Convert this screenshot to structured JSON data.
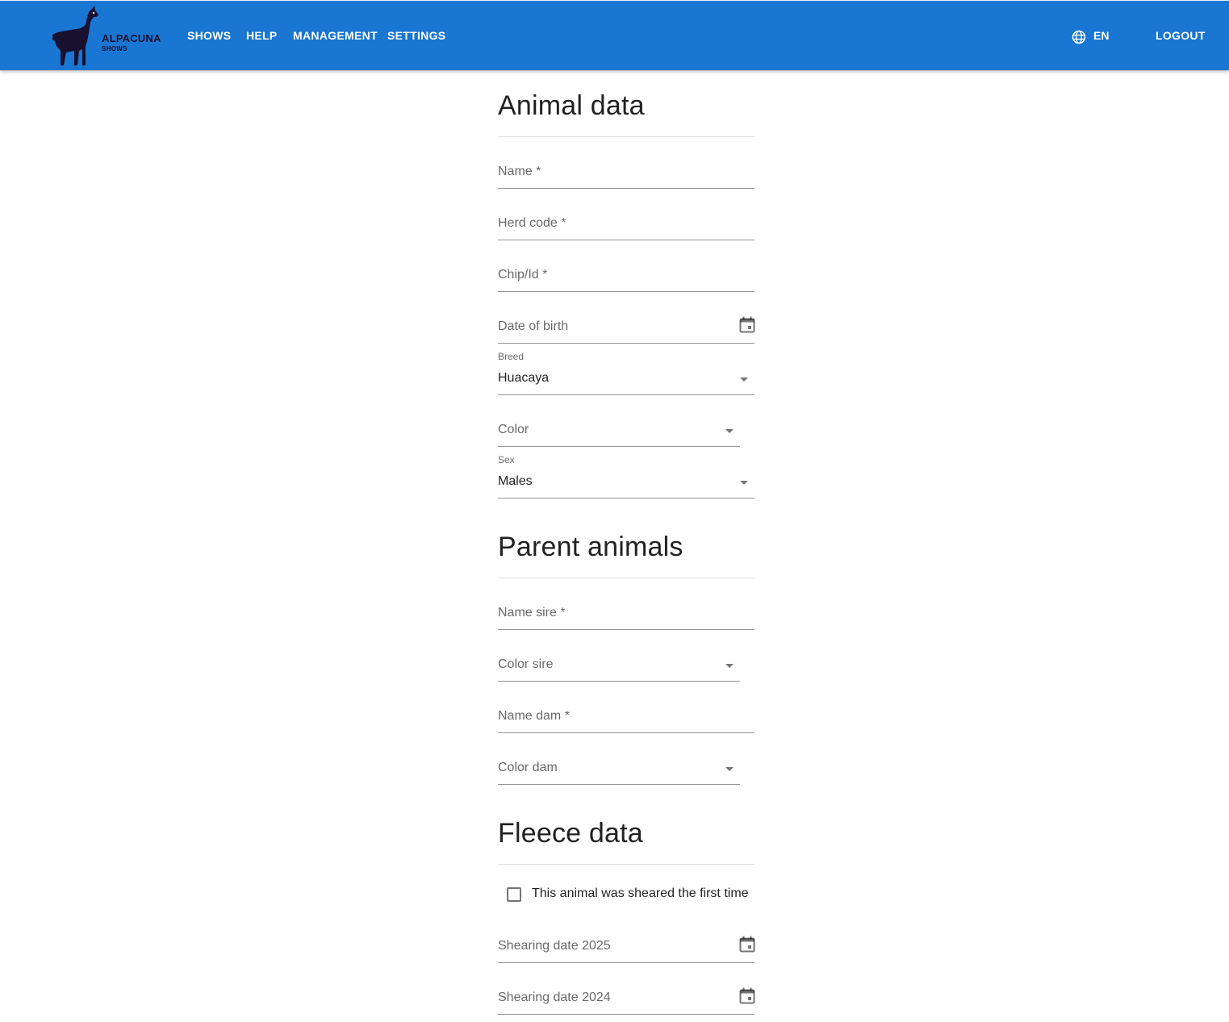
{
  "header": {
    "logo": {
      "title": "ALPACUNA",
      "subtitle": "SHOWS"
    },
    "nav": [
      "SHOWS",
      "HELP",
      "MANAGEMENT",
      "SETTINGS"
    ],
    "language": "EN",
    "logout": "LOGOUT",
    "accent_color": "#1976d2"
  },
  "sections": {
    "animal": {
      "title": "Animal data",
      "name_label": "Name *",
      "herd_code_label": "Herd code *",
      "chip_label": "Chip/Id *",
      "dob_label": "Date of birth",
      "breed_label": "Breed",
      "breed_value": "Huacaya",
      "color_label": "Color",
      "sex_label": "Sex",
      "sex_value": "Males"
    },
    "parents": {
      "title": "Parent animals",
      "name_sire_label": "Name sire *",
      "color_sire_label": "Color sire",
      "name_dam_label": "Name dam *",
      "color_dam_label": "Color dam"
    },
    "fleece": {
      "title": "Fleece data",
      "first_shearing_label": "This animal was sheared the first time",
      "first_shearing_checked": false,
      "shearing_2025_label": "Shearing date 2025",
      "shearing_2024_label": "Shearing date 2024"
    }
  },
  "icons": {
    "language": "globe-icon",
    "date": "calendar-icon",
    "dropdown": "arrow-drop-down-icon"
  }
}
